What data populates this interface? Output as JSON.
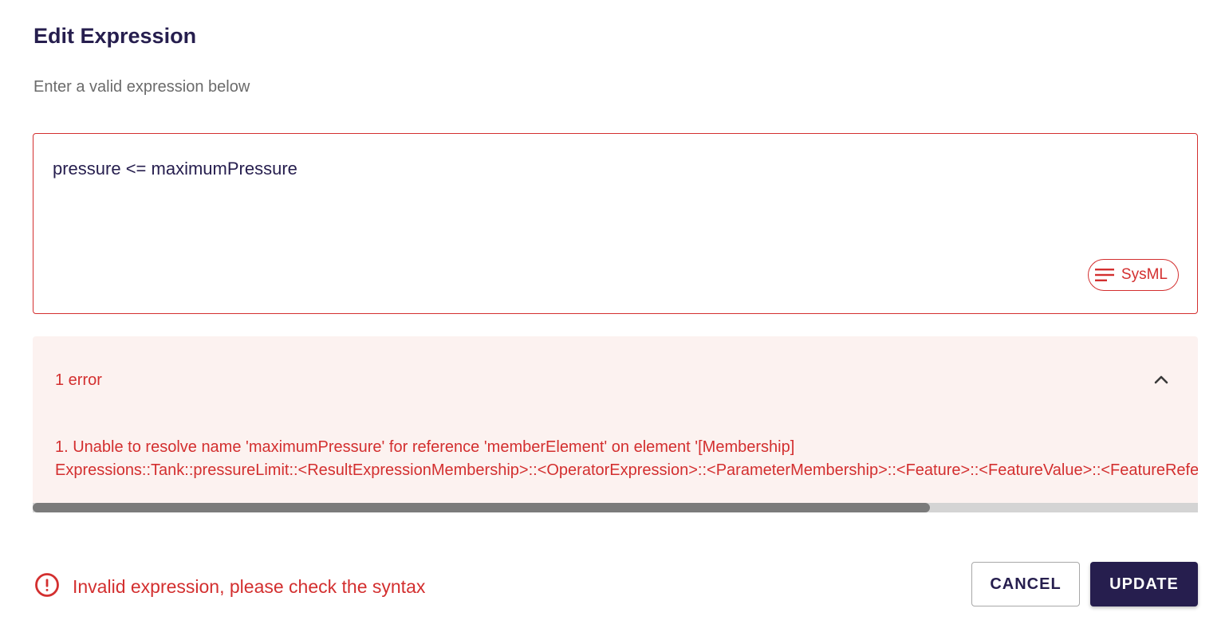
{
  "dialog": {
    "title": "Edit Expression",
    "subtitle": "Enter a valid expression below"
  },
  "editor": {
    "value": "pressure <= maximumPressure",
    "language_chip": {
      "label": "SysML",
      "icon": "text-lines-icon"
    }
  },
  "errors": {
    "summary": "1 error",
    "toggle_icon": "chevron-up-icon",
    "items": [
      {
        "line1": "1. Unable to resolve name 'maximumPressure' for reference 'memberElement' on element '[Membership]",
        "line2": "Expressions::Tank::pressureLimit::<ResultExpressionMembership>::<OperatorExpression>::<ParameterMembership>::<Feature>::<FeatureValue>::<FeatureReferenceExpression>::<Membership>'"
      }
    ],
    "scroll_position": 0.77
  },
  "footer": {
    "status_icon": "alert-circle-icon",
    "status_text": "Invalid expression, please check the syntax",
    "cancel_label": "CANCEL",
    "update_label": "UPDATE"
  },
  "colors": {
    "primary": "#261e4e",
    "error": "#d32f2f",
    "error_background": "#fcf2f0"
  }
}
